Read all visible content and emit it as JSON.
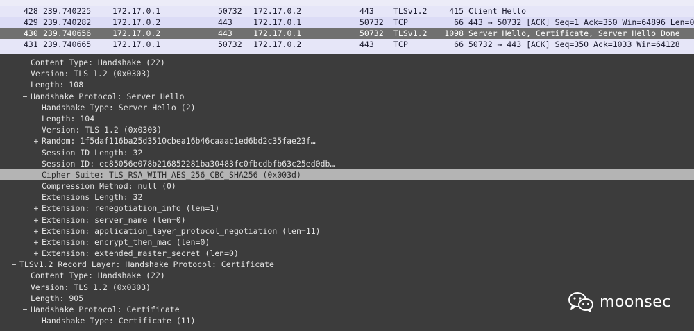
{
  "packet_list": {
    "rows": [
      {
        "no": "428",
        "time": "239.740225",
        "src": "172.17.0.1",
        "sport": "50732",
        "dst": "172.17.0.2",
        "dport": "443",
        "proto": "TLSv1.2",
        "len": "415",
        "info": "Client Hello"
      },
      {
        "no": "429",
        "time": "239.740282",
        "src": "172.17.0.2",
        "sport": "443",
        "dst": "172.17.0.1",
        "dport": "50732",
        "proto": "TCP",
        "len": "66",
        "info": "443 → 50732 [ACK] Seq=1 Ack=350 Win=64896 Len=0"
      },
      {
        "no": "430",
        "time": "239.740656",
        "src": "172.17.0.2",
        "sport": "443",
        "dst": "172.17.0.1",
        "dport": "50732",
        "proto": "TLSv1.2",
        "len": "1098",
        "info": "Server Hello, Certificate, Server Hello Done"
      },
      {
        "no": "431",
        "time": "239.740665",
        "src": "172.17.0.1",
        "sport": "50732",
        "dst": "172.17.0.2",
        "dport": "443",
        "proto": "TCP",
        "len": "66",
        "info": "50732 → 443 [ACK] Seq=350 Ack=1033 Win=64128"
      }
    ],
    "selected_no": "430"
  },
  "details": {
    "lines": [
      {
        "text": "Content Type: Handshake (22)",
        "toggle": ""
      },
      {
        "text": "Version: TLS 1.2 (0x0303)",
        "toggle": ""
      },
      {
        "text": "Length: 108",
        "toggle": ""
      },
      {
        "text": "Handshake Protocol: Server Hello",
        "toggle": "−"
      },
      {
        "text": "Handshake Type: Server Hello (2)",
        "toggle": ""
      },
      {
        "text": "Length: 104",
        "toggle": ""
      },
      {
        "text": "Version: TLS 1.2 (0x0303)",
        "toggle": ""
      },
      {
        "text": "Random: 1f5daf116ba25d3510cbea16b46caaac1ed6bd2c35fae23f…",
        "toggle": "+"
      },
      {
        "text": "Session ID Length: 32",
        "toggle": ""
      },
      {
        "text": "Session ID: ec85056e078b216852281ba30483fc0fbcdbfb63c25ed0db…",
        "toggle": ""
      },
      {
        "text": "Cipher Suite: TLS_RSA_WITH_AES_256_CBC_SHA256 (0x003d)",
        "toggle": ""
      },
      {
        "text": "Compression Method: null (0)",
        "toggle": ""
      },
      {
        "text": "Extensions Length: 32",
        "toggle": ""
      },
      {
        "text": "Extension: renegotiation_info (len=1)",
        "toggle": "+"
      },
      {
        "text": "Extension: server_name (len=0)",
        "toggle": "+"
      },
      {
        "text": "Extension: application_layer_protocol_negotiation (len=11)",
        "toggle": "+"
      },
      {
        "text": "Extension: encrypt_then_mac (len=0)",
        "toggle": "+"
      },
      {
        "text": "Extension: extended_master_secret (len=0)",
        "toggle": "+"
      },
      {
        "text": "TLSv1.2 Record Layer: Handshake Protocol: Certificate",
        "toggle": "−"
      },
      {
        "text": "Content Type: Handshake (22)",
        "toggle": ""
      },
      {
        "text": "Version: TLS 1.2 (0x0303)",
        "toggle": ""
      },
      {
        "text": "Length: 905",
        "toggle": ""
      },
      {
        "text": "Handshake Protocol: Certificate",
        "toggle": "−"
      },
      {
        "text": "Handshake Type: Certificate (11)",
        "toggle": ""
      }
    ],
    "highlighted_text": "Cipher Suite: TLS_RSA_WITH_AES_256_CBC_SHA256 (0x003d)"
  },
  "watermark": {
    "text": "moonsec",
    "icon": "wechat-icon"
  },
  "colors": {
    "selected_row": "#707070",
    "highlight_row": "#b4b4b4",
    "detail_bg": "#3c3c3c",
    "list_bg": "#e6e6f8"
  }
}
